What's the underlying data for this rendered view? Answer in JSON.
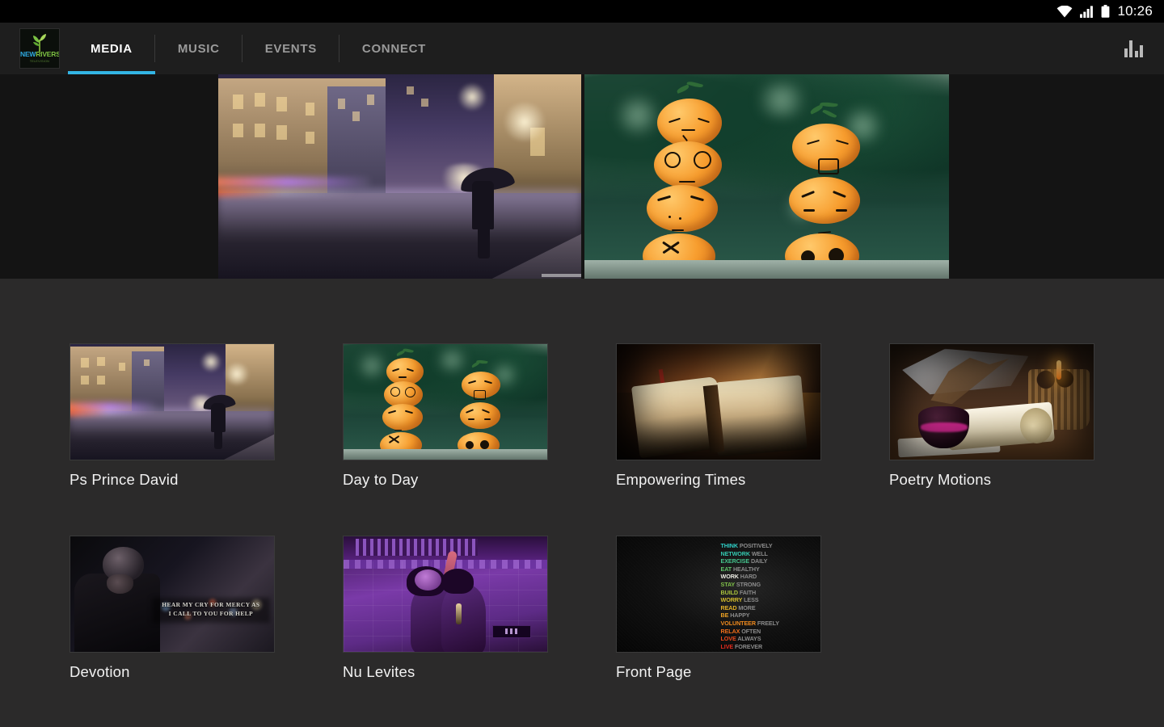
{
  "statusbar": {
    "time": "10:26",
    "icons": [
      "wifi-icon",
      "cellular-signal-icon",
      "battery-icon"
    ]
  },
  "appbar": {
    "logo": {
      "name": "newrivers-logo",
      "text_part1": "NEW",
      "text_part2": "RIVERS",
      "subtitle": "TELEVISION"
    },
    "tabs": [
      {
        "label": "MEDIA",
        "active": true
      },
      {
        "label": "MUSIC",
        "active": false
      },
      {
        "label": "EVENTS",
        "active": false
      },
      {
        "label": "CONNECT",
        "active": false
      }
    ],
    "action_icon": "bar-chart-icon",
    "accent_color": "#33b5e5",
    "background": "#1e1e1e"
  },
  "hero": {
    "background": "#141414",
    "slides": [
      {
        "id": "rainy-city-night",
        "alt": "Person with umbrella on a rainy city street at night"
      },
      {
        "id": "stacked-oranges",
        "alt": "Stacked tangerines with drawn cartoon faces"
      }
    ]
  },
  "grid": {
    "background": "#2b2a2a",
    "rows": [
      [
        {
          "title": "Ps Prince David",
          "art": "rainy-city-night"
        },
        {
          "title": "Day to Day",
          "art": "stacked-oranges"
        },
        {
          "title": "Empowering Times",
          "art": "open-book"
        },
        {
          "title": "Poetry Motions",
          "art": "quill-and-scroll"
        }
      ],
      [
        {
          "title": "Devotion",
          "art": "praying-man",
          "overlay_line1": "HEAR MY CRY FOR MERCY AS",
          "overlay_line2": "I CALL TO YOU FOR HELP"
        },
        {
          "title": "Nu Levites",
          "art": "purple-stage-singers"
        },
        {
          "title": "Front Page",
          "art": "motivational-word-poster"
        }
      ]
    ]
  },
  "front_page_poster": {
    "lines": [
      {
        "bold": "THINK",
        "rest": "POSITIVELY",
        "color": "#2fd0c8"
      },
      {
        "bold": "NETWORK",
        "rest": "WELL",
        "color": "#34c9b0"
      },
      {
        "bold": "EXERCISE",
        "rest": "DAILY",
        "color": "#45c48d"
      },
      {
        "bold": "EAT",
        "rest": "HEALTHY",
        "color": "#5fc169"
      },
      {
        "bold": "WORK",
        "rest": "HARD",
        "color": "#ecece4"
      },
      {
        "bold": "STAY",
        "rest": "STRONG",
        "color": "#7fbf4a"
      },
      {
        "bold": "BUILD",
        "rest": "FAITH",
        "color": "#a8c03c"
      },
      {
        "bold": "WORRY",
        "rest": "LESS",
        "color": "#d2bb2d"
      },
      {
        "bold": "READ",
        "rest": "MORE",
        "color": "#e3b128"
      },
      {
        "bold": "BE",
        "rest": "HAPPY",
        "color": "#eda124"
      },
      {
        "bold": "VOLUNTEER",
        "rest": "FREELY",
        "color": "#f08a1d"
      },
      {
        "bold": "RELAX",
        "rest": "OFTEN",
        "color": "#ef6d1a"
      },
      {
        "bold": "LOVE",
        "rest": "ALWAYS",
        "color": "#ec4a1b"
      },
      {
        "bold": "LIVE",
        "rest": "FOREVER",
        "color": "#e02a1c"
      }
    ]
  }
}
